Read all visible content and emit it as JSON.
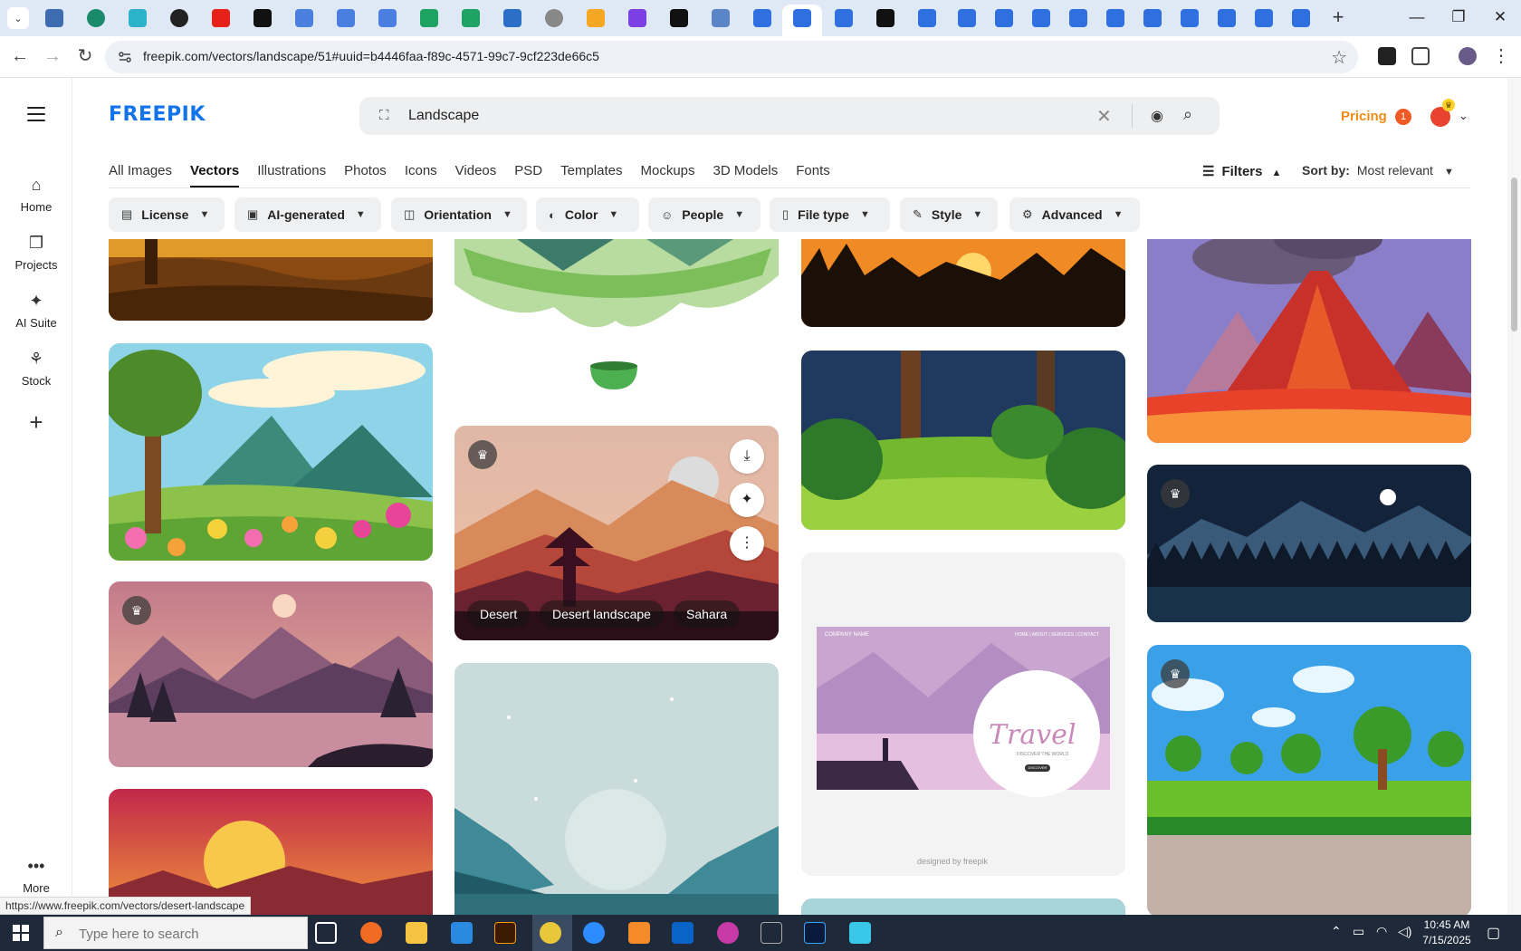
{
  "browser": {
    "url": "freepik.com/vectors/landscape/51#uuid=b4446faa-f89c-4571-99c7-9cf223de66c5",
    "status_url": "https://www.freepik.com/vectors/desert-landscape"
  },
  "header": {
    "logo": "FREEPIK",
    "search_value": "Landscape",
    "pricing": "Pricing",
    "notification_count": "1"
  },
  "sidebar": {
    "items": [
      {
        "label": "Home",
        "icon": "home-icon"
      },
      {
        "label": "Projects",
        "icon": "folders-icon"
      },
      {
        "label": "AI Suite",
        "icon": "sparkle-icon"
      },
      {
        "label": "Stock",
        "icon": "stock-icon"
      }
    ],
    "more": "More"
  },
  "categories": {
    "tabs": [
      "All Images",
      "Vectors",
      "Illustrations",
      "Photos",
      "Icons",
      "Videos",
      "PSD",
      "Templates",
      "Mockups",
      "3D Models",
      "Fonts"
    ],
    "active": "Vectors",
    "filters_label": "Filters",
    "sort_label": "Sort by:",
    "sort_value": "Most relevant"
  },
  "filter_chips": [
    "License",
    "AI-generated",
    "Orientation",
    "Color",
    "People",
    "File type",
    "Style",
    "Advanced"
  ],
  "hover_card": {
    "tags": [
      "Desert",
      "Desert landscape",
      "Sahara"
    ]
  },
  "travel_card": {
    "company": "COMPANY NAME",
    "nav": "HOME  |  ABOUT  |  SERVICES  |  CONTACT",
    "title": "Travel",
    "subtitle": "DISCOVER THE WORLD",
    "button": "DISCOVER",
    "credit": "designed by freepik"
  },
  "taskbar": {
    "search_placeholder": "Type here to search",
    "time": "10:45 AM",
    "date": "7/15/2025"
  },
  "colors": {
    "brand": "#1273eb",
    "pricing": "#f08c15",
    "taskbar": "#1e2a3a"
  }
}
